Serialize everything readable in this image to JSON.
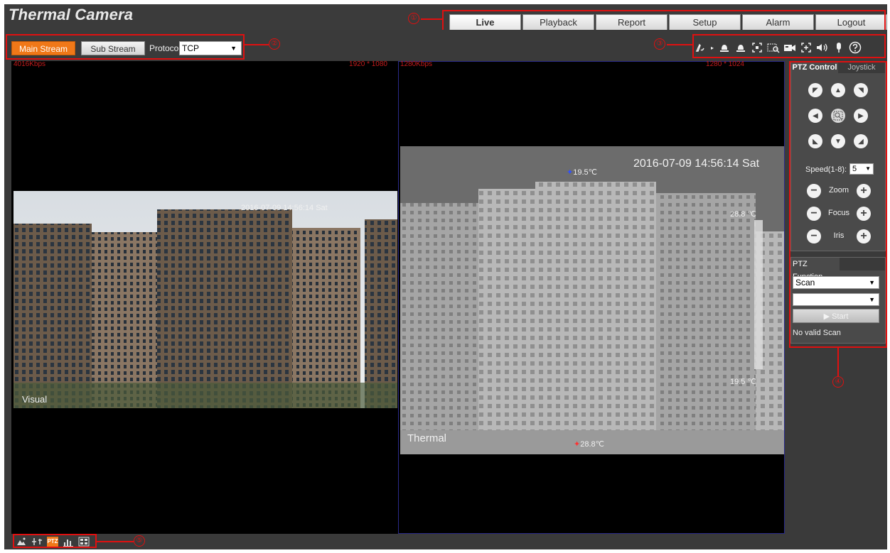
{
  "app": {
    "title": "Thermal Camera"
  },
  "nav": {
    "tabs": [
      "Live",
      "Playback",
      "Report",
      "Setup",
      "Alarm",
      "Logout"
    ],
    "active": "Live"
  },
  "stream": {
    "main_label": "Main Stream",
    "sub_label": "Sub Stream",
    "protocol_label": "Protocol",
    "protocol_value": "TCP"
  },
  "toolbar": {
    "icons": [
      "draw-pen-icon",
      "expand-arrow-icon",
      "alarm-bell-icon",
      "alarm-bell-2-icon",
      "fullscreen-icon",
      "zoom-region-icon",
      "record-icon",
      "capture-icon",
      "audio-icon",
      "microphone-icon",
      "help-icon"
    ]
  },
  "video": {
    "left": {
      "bitrate": "4016Kbps",
      "resolution": "1920 * 1080",
      "osd_time": "2016-07-09 14:56:14 Sat",
      "osd_label": "Visual"
    },
    "right": {
      "bitrate": "1280Kbps",
      "resolution": "1280 * 1024",
      "osd_time": "2016-07-09 14:56:14 Sat",
      "osd_label": "Thermal",
      "min_temp": "19.5℃",
      "max_temp": "28.8℃",
      "scale_top": "28.8 ℃",
      "scale_bottom": "19.5 ℃"
    }
  },
  "ptz": {
    "tab_control": "PTZ Control",
    "tab_joystick": "Joystick",
    "speed_label": "Speed(1-8):",
    "speed_value": "5",
    "zoom_label": "Zoom",
    "focus_label": "Focus",
    "iris_label": "Iris"
  },
  "ptz_function": {
    "title": "PTZ Function",
    "mode_value": "Scan",
    "second_value": "",
    "start_label": "▶ Start",
    "status": "No valid Scan"
  },
  "annotations": {
    "n1": "①",
    "n2": "②",
    "n3": "③",
    "n4": "④",
    "n5": "⑤"
  },
  "bottom": {
    "icons": [
      "image-adjust-icon",
      "window-adjust-icon",
      "ptz-icon",
      "stats-icon",
      "split-view-icon"
    ],
    "ptz_text": "PTZ"
  },
  "colors": {
    "accent": "#f07818",
    "annotation": "#e01010",
    "bitrate": "#c81b1b"
  }
}
